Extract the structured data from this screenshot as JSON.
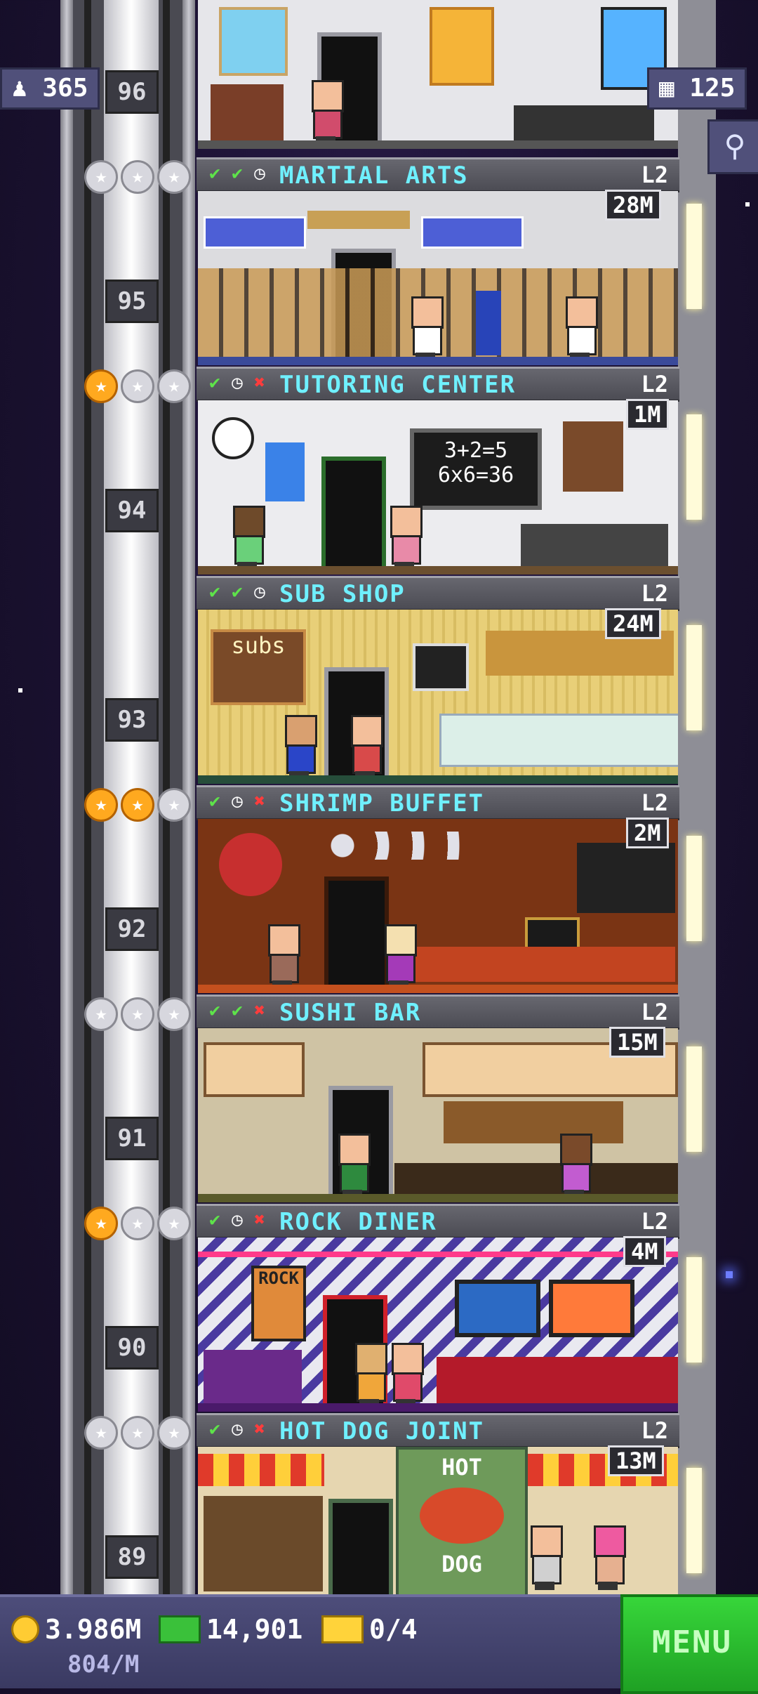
{
  "counters": {
    "population": "365",
    "floors": "125"
  },
  "floors": [
    {
      "number": "95",
      "name": "MARTIAL ARTS",
      "level": "L2",
      "stock": "28M",
      "stars_gold": 0,
      "checks": [
        "ok",
        "ok",
        "clock"
      ]
    },
    {
      "number": "94",
      "name": "TUTORING CENTER",
      "level": "L2",
      "stock": "1M",
      "stars_gold": 1,
      "checks": [
        "ok",
        "clock",
        "x"
      ],
      "board_line1": "3+2=5",
      "board_line2": "6x6=36"
    },
    {
      "number": "93",
      "name": "SUB SHOP",
      "level": "L2",
      "stock": "24M",
      "stars_gold": 0,
      "checks": [
        "ok",
        "ok",
        "clock"
      ],
      "sign": "subs"
    },
    {
      "number": "92",
      "name": "SHRIMP BUFFET",
      "level": "L2",
      "stock": "2M",
      "stars_gold": 2,
      "checks": [
        "ok",
        "clock",
        "x"
      ]
    },
    {
      "number": "91",
      "name": "SUSHI BAR",
      "level": "L2",
      "stock": "15M",
      "stars_gold": 0,
      "checks": [
        "ok",
        "ok",
        "x"
      ]
    },
    {
      "number": "90",
      "name": "ROCK DINER",
      "level": "L2",
      "stock": "4M",
      "stars_gold": 1,
      "checks": [
        "ok",
        "clock",
        "x"
      ],
      "sign": "ROCK"
    },
    {
      "number": "89",
      "name": "HOT DOG JOINT",
      "level": "L2",
      "stock": "13M",
      "stars_gold": 0,
      "checks": [
        "ok",
        "clock",
        "x"
      ],
      "sign_top": "HOT",
      "sign_bottom": "DOG"
    }
  ],
  "top_floor_number": "96",
  "bottom_bar": {
    "coins": "3.986M",
    "income": "804/M",
    "bux": "14,901",
    "vip": "0/4",
    "menu_label": "MENU"
  },
  "colors": {
    "floor_name": "#6ff0ff",
    "check": "#5ee34a",
    "x_mark": "#ff3c3c",
    "menu_green": "#1fa124",
    "star_gold": "#ffa91f"
  }
}
